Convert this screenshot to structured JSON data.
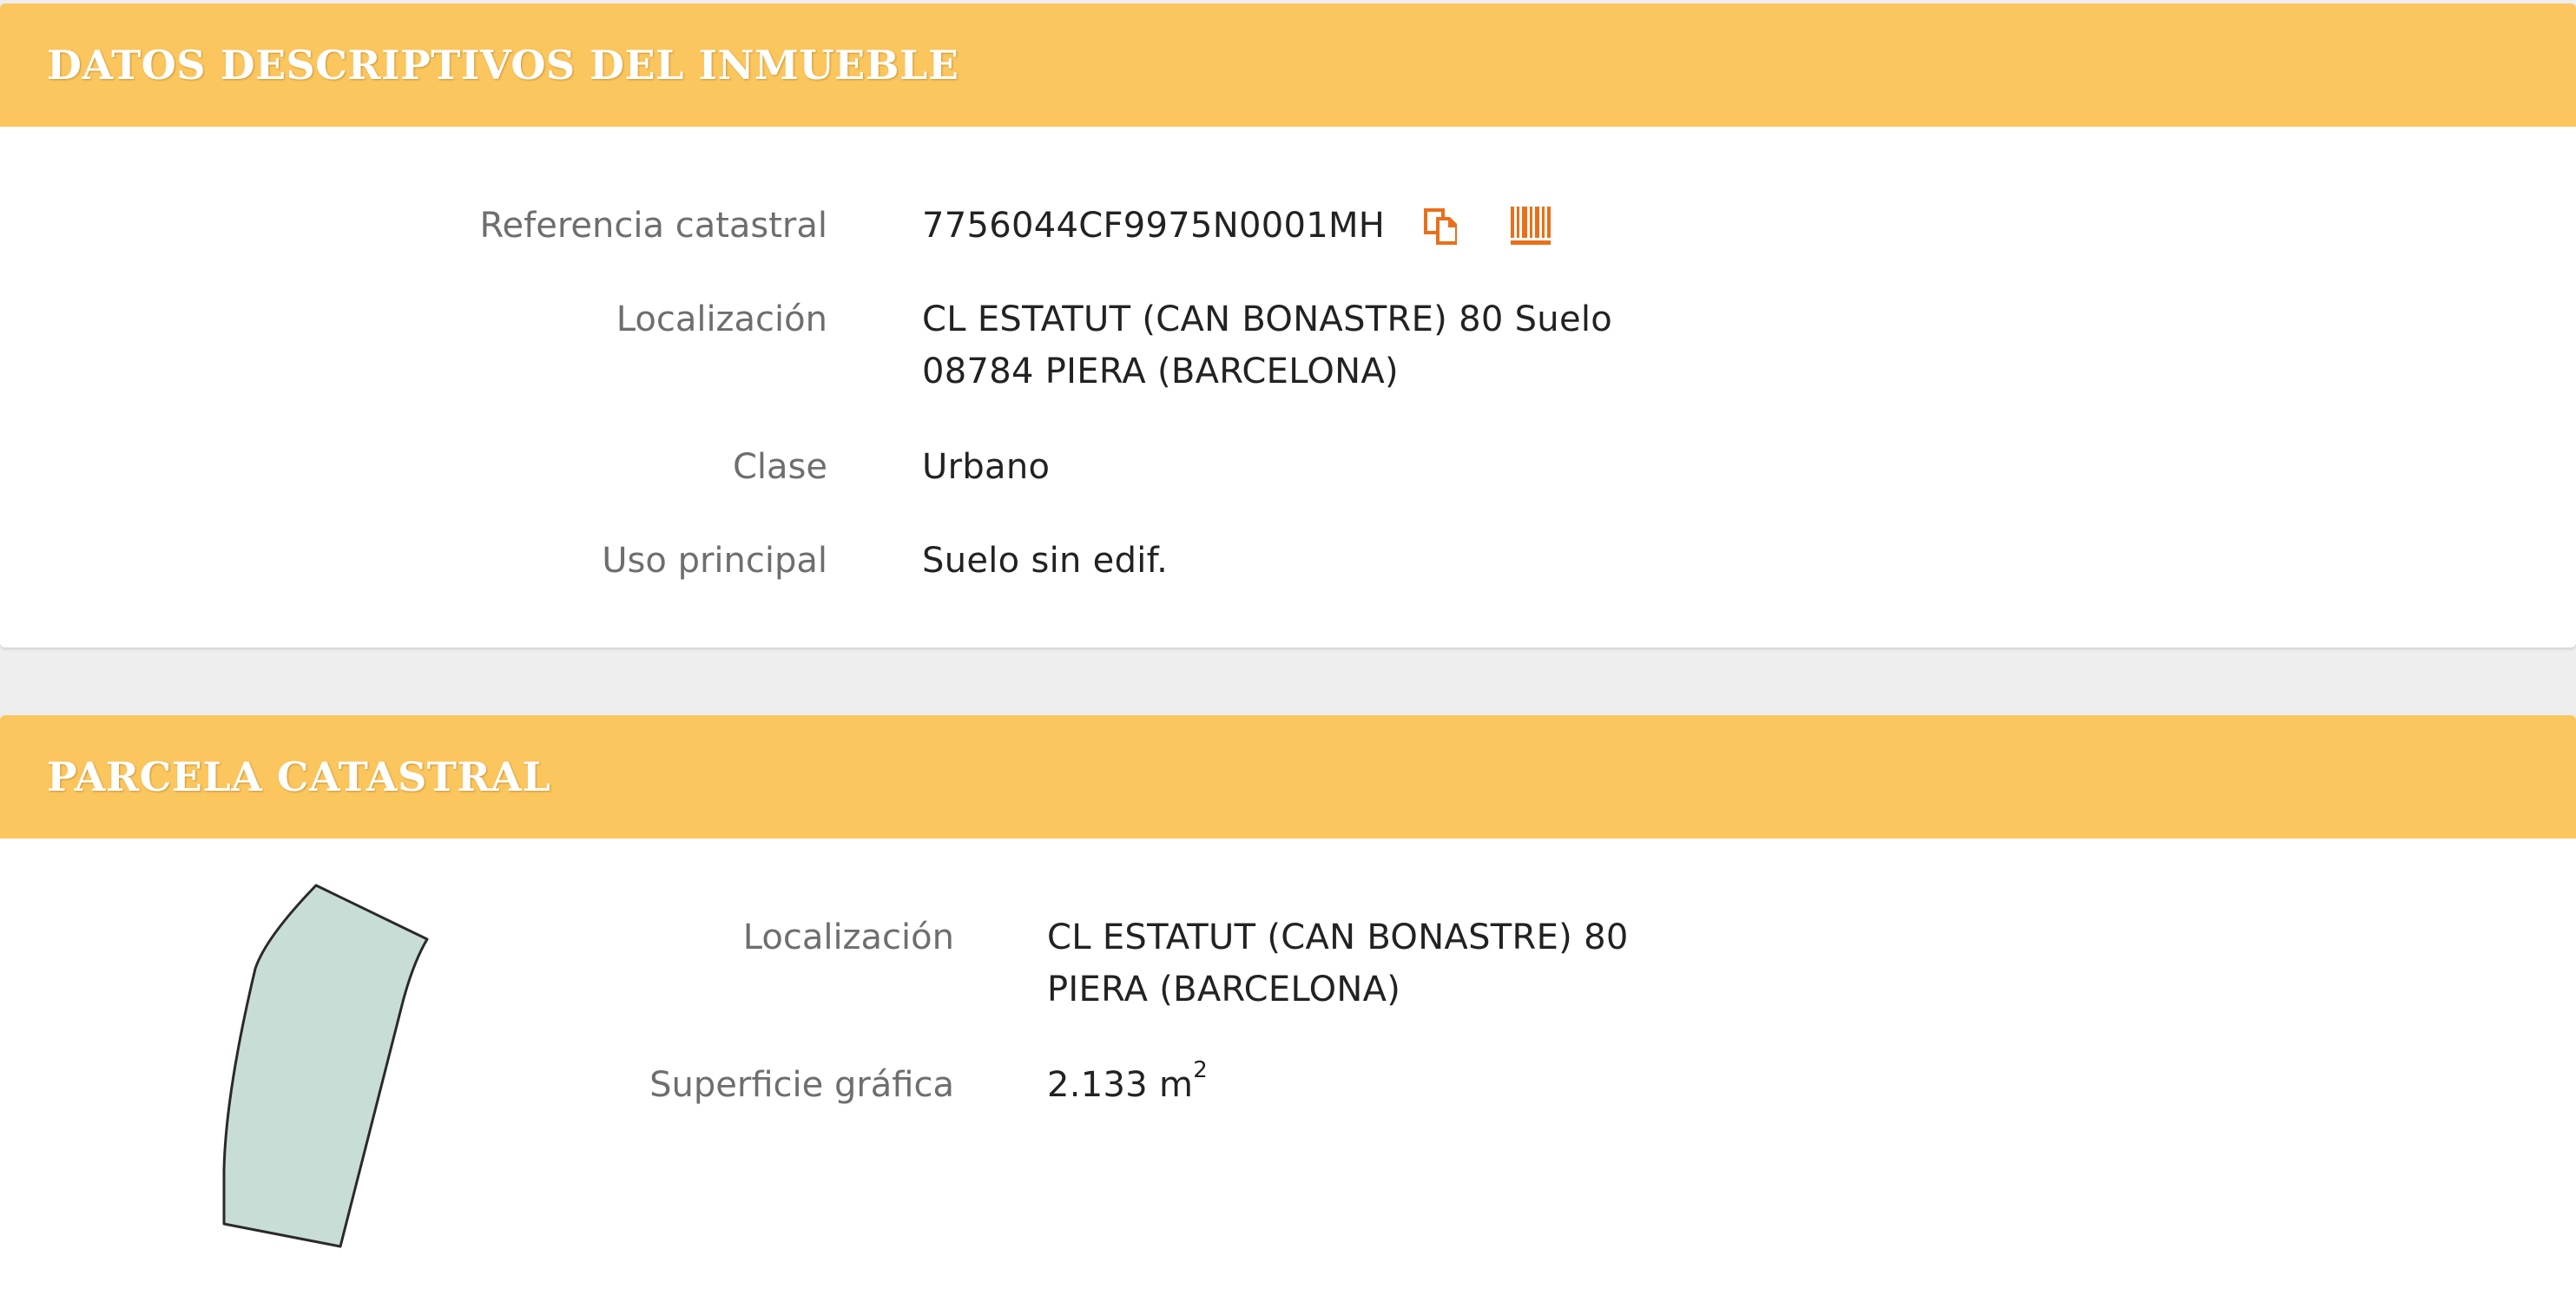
{
  "datos": {
    "title": "DATOS DESCRIPTIVOS DEL INMUEBLE",
    "rows": [
      {
        "label": "Referencia catastral",
        "value": "7756044CF9975N0001MH"
      },
      {
        "label": "Localización",
        "value_line1": "CL ESTATUT (CAN BONASTRE) 80 Suelo",
        "value_line2": "08784 PIERA (BARCELONA)"
      },
      {
        "label": "Clase",
        "value": "Urbano"
      },
      {
        "label": "Uso principal",
        "value": "Suelo sin edif."
      }
    ],
    "icons": {
      "copy": "copy-icon",
      "barcode": "barcode-icon"
    }
  },
  "parcela": {
    "title": "PARCELA CATASTRAL",
    "rows": [
      {
        "label": "Localización",
        "value_line1": "CL ESTATUT (CAN BONASTRE) 80",
        "value_line2": "PIERA (BARCELONA)"
      },
      {
        "label": "Superficie gráfica",
        "value": "2.133 m",
        "unit_sup": "2"
      }
    ],
    "parcel_fill_color": "#c8ddd5"
  },
  "colors": {
    "header": "#fcc65e",
    "icon_accent": "#e8701a"
  }
}
